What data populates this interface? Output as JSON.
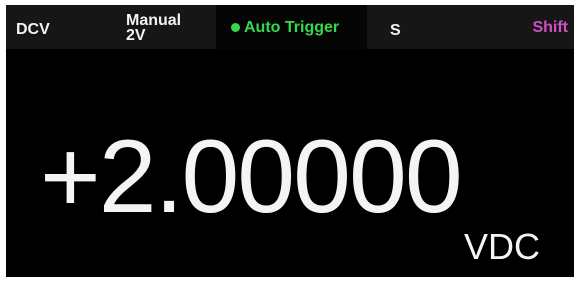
{
  "status_bar": {
    "function": "DCV",
    "range_mode": "Manual",
    "range_value": "2V",
    "trigger": "Auto Trigger",
    "speed": "S",
    "shift": "Shift"
  },
  "display": {
    "reading": "+2.00000",
    "unit": "VDC"
  },
  "colors": {
    "screen_background": "#000000",
    "status_bar_background": "#161616",
    "trigger_indicator": "#38d64a",
    "shift_label": "#d04fc4",
    "text": "#f4f4f4"
  },
  "icons": {
    "trigger_indicator": "status-dot-icon"
  }
}
